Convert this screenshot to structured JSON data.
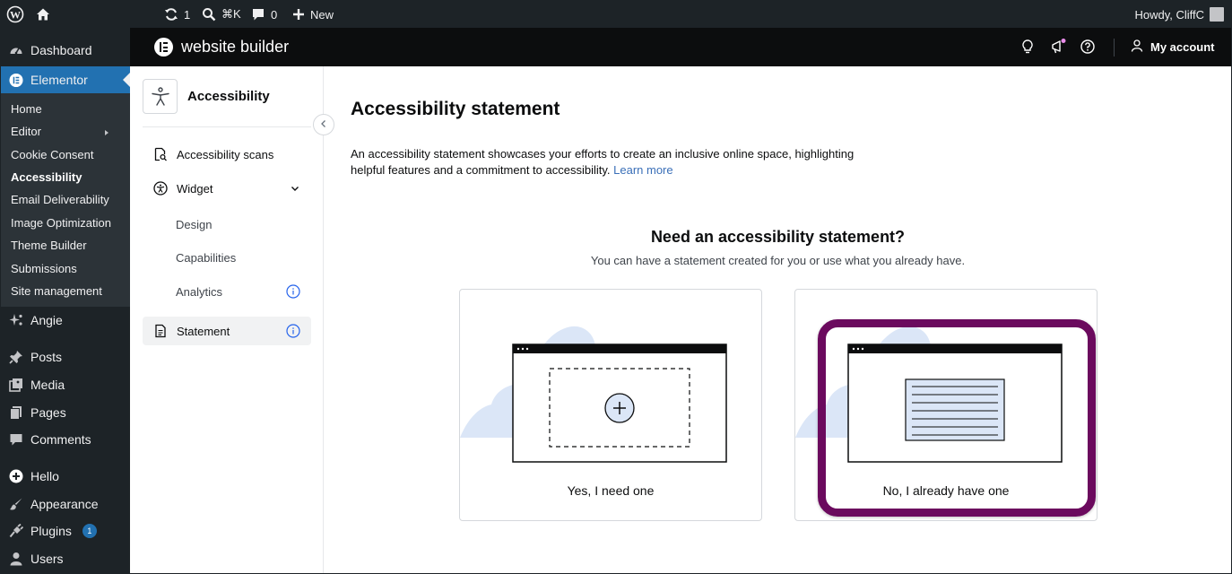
{
  "admin_bar": {
    "updates_count": "1",
    "search_shortcut": "⌘K",
    "comments_count": "0",
    "new_label": "New",
    "howdy": "Howdy, CliffC"
  },
  "sidebar": {
    "dashboard": "Dashboard",
    "elementor": "Elementor",
    "submenu": [
      "Home",
      "Editor",
      "Cookie Consent",
      "Accessibility",
      "Email Deliverability",
      "Image Optimization",
      "Theme Builder",
      "Submissions",
      "Site management"
    ],
    "angie": "Angie",
    "posts": "Posts",
    "media": "Media",
    "pages": "Pages",
    "comments": "Comments",
    "hello": "Hello",
    "appearance": "Appearance",
    "plugins": "Plugins",
    "plugins_badge": "1",
    "users": "Users"
  },
  "topbar": {
    "brand": "website builder",
    "my_account": "My account"
  },
  "inner_nav": {
    "plugin_name": "Accessibility",
    "scans": "Accessibility scans",
    "widget": "Widget",
    "design": "Design",
    "capabilities": "Capabilities",
    "analytics": "Analytics",
    "statement": "Statement"
  },
  "main": {
    "title": "Accessibility statement",
    "description": "An accessibility statement showcases your efforts to create an inclusive online space, highlighting helpful features and a commitment to accessibility.",
    "learn_more": "Learn more",
    "question": "Need an accessibility statement?",
    "subtitle": "You can have a statement created for you or use what you already have.",
    "option_yes": "Yes, I need one",
    "option_no": "No, I already have one"
  },
  "colors": {
    "wp_dark": "#1d2327",
    "wp_blue": "#2271b1",
    "elementor_black": "#0c0d0e",
    "illustration_blue": "#dbe6f7",
    "highlight_purple": "#6b0a5e",
    "notification_dot": "#e88ce8"
  }
}
